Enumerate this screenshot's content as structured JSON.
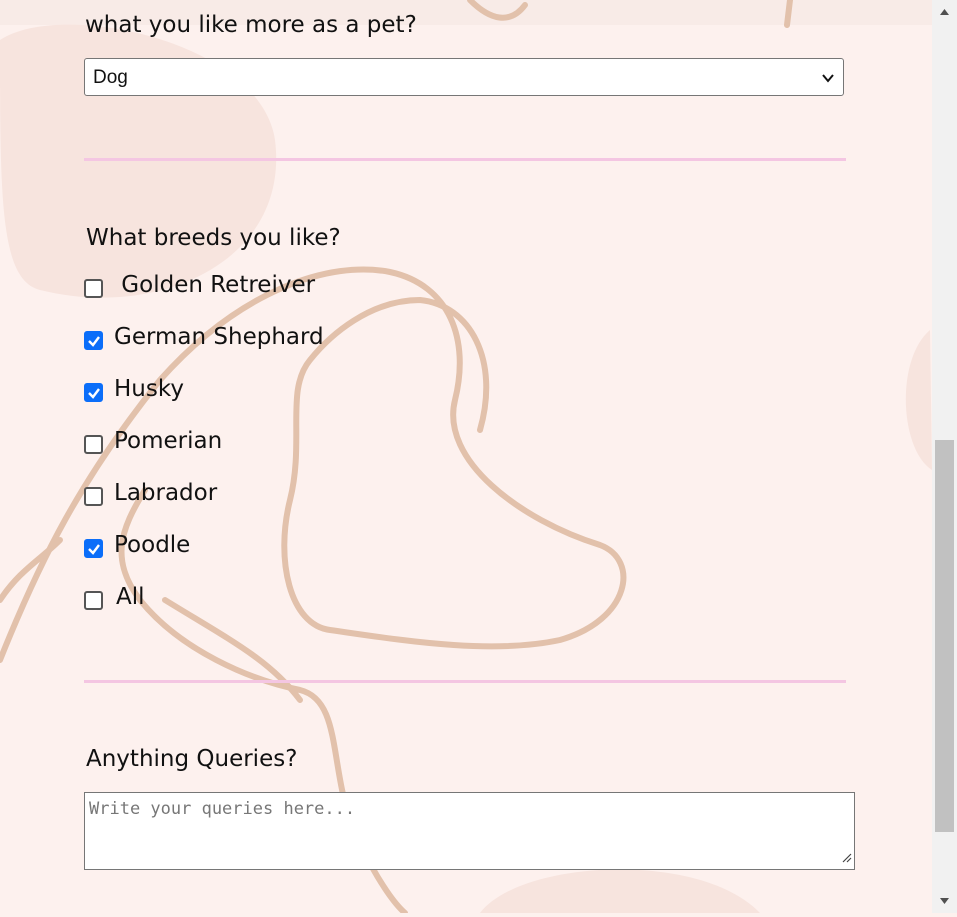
{
  "questions": {
    "pet": "what you like more as a pet?",
    "breeds": "What breeds you like?",
    "queries": "Anything Queries?"
  },
  "pet_select": {
    "selected": "Dog"
  },
  "breeds": [
    {
      "label": " Golden Retreiver",
      "checked": false
    },
    {
      "label": "German Shephard",
      "checked": true
    },
    {
      "label": "Husky",
      "checked": true
    },
    {
      "label": "Pomerian",
      "checked": false
    },
    {
      "label": "Labrador",
      "checked": false
    },
    {
      "label": "Poodle",
      "checked": true
    },
    {
      "label": "All",
      "checked": false
    }
  ],
  "queries_field": {
    "placeholder": "Write your queries here..."
  },
  "colors": {
    "checkbox_accent": "#0b6ef9",
    "divider": "#f4c6e2",
    "page_bg": "#fdf1ee"
  },
  "icons": {
    "select": "chevron-down-icon",
    "scroll_up": "arrow-up-icon",
    "scroll_down": "arrow-down-icon"
  }
}
